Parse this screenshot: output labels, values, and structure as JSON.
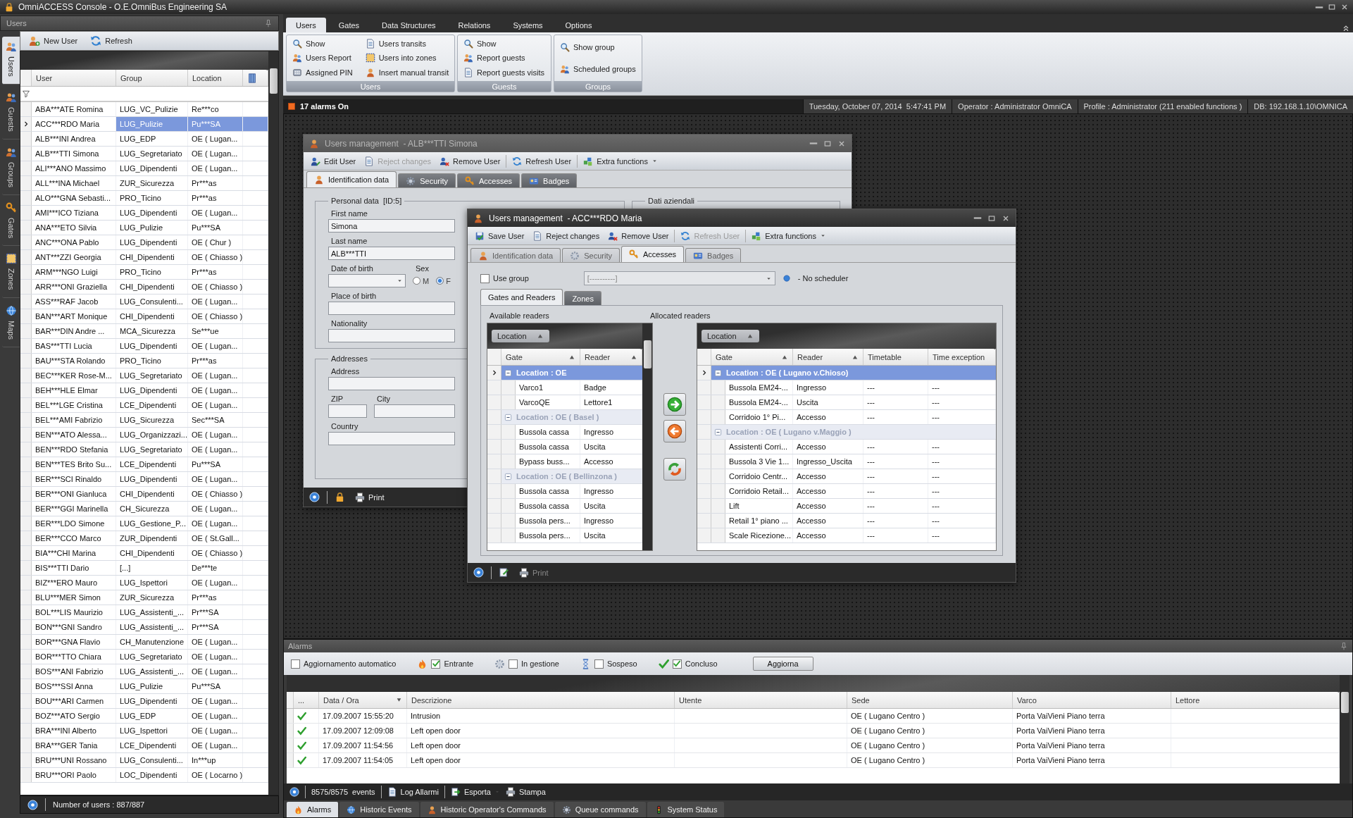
{
  "window": {
    "title": "OmniACCESS Console - O.E.OmniBus Engineering SA"
  },
  "side_tabs": [
    {
      "label": "Users",
      "selected": true
    },
    {
      "label": "Guests",
      "selected": false
    },
    {
      "label": "Groups",
      "selected": false
    },
    {
      "label": "Gates",
      "selected": false
    },
    {
      "label": "Zones",
      "selected": false
    },
    {
      "label": "Maps",
      "selected": false
    }
  ],
  "users_panel": {
    "title": "Users",
    "toolbar": [
      "New User",
      "Refresh"
    ],
    "columns": [
      "User",
      "Group",
      "Location"
    ],
    "rows": [
      {
        "user": "ABA***ATE Romina",
        "group": "LUG_VC_Pulizie",
        "location": "Re***co",
        "selected": false
      },
      {
        "user": "ACC***RDO Maria",
        "group": "LUG_Pulizie",
        "location": "Pu***SA",
        "selected": true
      },
      {
        "user": "ALB***INI Andrea",
        "group": "LUG_EDP",
        "location": "OE ( Lugan...",
        "selected": false
      },
      {
        "user": "ALB***TTI Simona",
        "group": "LUG_Segretariato",
        "location": "OE ( Lugan...",
        "selected": false
      },
      {
        "user": "ALI***ANO Massimo",
        "group": "LUG_Dipendenti",
        "location": "OE ( Lugan...",
        "selected": false
      },
      {
        "user": "ALL***INA Michael",
        "group": "ZUR_Sicurezza",
        "location": "Pr***as",
        "selected": false
      },
      {
        "user": "ALO***GNA Sebasti...",
        "group": "PRO_Ticino",
        "location": "Pr***as",
        "selected": false
      },
      {
        "user": "AMI***ICO Tiziana",
        "group": "LUG_Dipendenti",
        "location": "OE ( Lugan...",
        "selected": false
      },
      {
        "user": "ANA***ETO Silvia",
        "group": "LUG_Pulizie",
        "location": "Pu***SA",
        "selected": false
      },
      {
        "user": "ANC***ONA Pablo",
        "group": "LUG_Dipendenti",
        "location": "OE ( Chur )",
        "selected": false
      },
      {
        "user": "ANT***ZZI Georgia",
        "group": "CHI_Dipendenti",
        "location": "OE ( Chiasso )",
        "selected": false
      },
      {
        "user": "ARM***NGO Luigi",
        "group": "PRO_Ticino",
        "location": "Pr***as",
        "selected": false
      },
      {
        "user": "ARR***ONI Graziella",
        "group": "CHI_Dipendenti",
        "location": "OE ( Chiasso )",
        "selected": false
      },
      {
        "user": "ASS***RAF Jacob",
        "group": "LUG_Consulenti...",
        "location": "OE ( Lugan...",
        "selected": false
      },
      {
        "user": "BAN***ART Monique",
        "group": "CHI_Dipendenti",
        "location": "OE ( Chiasso )",
        "selected": false
      },
      {
        "user": "BAR***DIN Andre ...",
        "group": "MCA_Sicurezza",
        "location": "Se***ue",
        "selected": false
      },
      {
        "user": "BAS***TTI Lucia",
        "group": "LUG_Dipendenti",
        "location": "OE ( Lugan...",
        "selected": false
      },
      {
        "user": "BAU***STA Rolando",
        "group": "PRO_Ticino",
        "location": "Pr***as",
        "selected": false
      },
      {
        "user": "BEC***KER Rose-M...",
        "group": "LUG_Segretariato",
        "location": "OE ( Lugan...",
        "selected": false
      },
      {
        "user": "BEH***HLE Elmar",
        "group": "LUG_Dipendenti",
        "location": "OE ( Lugan...",
        "selected": false
      },
      {
        "user": "BEL***LGE Cristina",
        "group": "LCE_Dipendenti",
        "location": "OE ( Lugan...",
        "selected": false
      },
      {
        "user": "BEL***AMI Fabrizio",
        "group": "LUG_Sicurezza",
        "location": "Sec***SA",
        "selected": false
      },
      {
        "user": "BEN***ATO Alessa...",
        "group": "LUG_Organizzazi...",
        "location": "OE ( Lugan...",
        "selected": false
      },
      {
        "user": "BEN***RDO Stefania",
        "group": "LUG_Segretariato",
        "location": "OE ( Lugan...",
        "selected": false
      },
      {
        "user": "BEN***TES Brito Su...",
        "group": "LCE_Dipendenti",
        "location": "Pu***SA",
        "selected": false
      },
      {
        "user": "BER***SCI Rinaldo",
        "group": "LUG_Dipendenti",
        "location": "OE ( Lugan...",
        "selected": false
      },
      {
        "user": "BER***ONI Gianluca",
        "group": "CHI_Dipendenti",
        "location": "OE ( Chiasso )",
        "selected": false
      },
      {
        "user": "BER***GGI Marinella",
        "group": "CH_Sicurezza",
        "location": "OE ( Lugan...",
        "selected": false
      },
      {
        "user": "BER***LDO Simone",
        "group": "LUG_Gestione_P...",
        "location": "OE ( Lugan...",
        "selected": false
      },
      {
        "user": "BER***CCO Marco",
        "group": "ZUR_Dipendenti",
        "location": "OE ( St.Gall...",
        "selected": false
      },
      {
        "user": "BIA***CHI Marina",
        "group": "CHI_Dipendenti",
        "location": "OE ( Chiasso )",
        "selected": false
      },
      {
        "user": "BIS***TTI Dario",
        "group": "[...]",
        "location": "De***te",
        "selected": false
      },
      {
        "user": "BIZ***ERO Mauro",
        "group": "LUG_Ispettori",
        "location": "OE ( Lugan...",
        "selected": false
      },
      {
        "user": "BLU***MER Simon",
        "group": "ZUR_Sicurezza",
        "location": "Pr***as",
        "selected": false
      },
      {
        "user": "BOL***LIS Maurizio",
        "group": "LUG_Assistenti_...",
        "location": "Pr***SA",
        "selected": false
      },
      {
        "user": "BON***GNI Sandro",
        "group": "LUG_Assistenti_...",
        "location": "Pr***SA",
        "selected": false
      },
      {
        "user": "BOR***GNA Flavio",
        "group": "CH_Manutenzione",
        "location": "OE ( Lugan...",
        "selected": false
      },
      {
        "user": "BOR***TTO Chiara",
        "group": "LUG_Segretariato",
        "location": "OE ( Lugan...",
        "selected": false
      },
      {
        "user": "BOS***ANI Fabrizio",
        "group": "LUG_Assistenti_...",
        "location": "OE ( Lugan...",
        "selected": false
      },
      {
        "user": "BOS***SSI Anna",
        "group": "LUG_Pulizie",
        "location": "Pu***SA",
        "selected": false
      },
      {
        "user": "BOU***ARI Carmen",
        "group": "LUG_Dipendenti",
        "location": "OE ( Lugan...",
        "selected": false
      },
      {
        "user": "BOZ***ATO Sergio",
        "group": "LUG_EDP",
        "location": "OE ( Lugan...",
        "selected": false
      },
      {
        "user": "BRA***INI Alberto",
        "group": "LUG_Ispettori",
        "location": "OE ( Lugan...",
        "selected": false
      },
      {
        "user": "BRA***GER Tania",
        "group": "LCE_Dipendenti",
        "location": "OE ( Lugan...",
        "selected": false
      },
      {
        "user": "BRU***UNI Rossano",
        "group": "LUG_Consulenti...",
        "location": "In***up",
        "selected": false
      },
      {
        "user": "BRU***ORI Paolo",
        "group": "LOC_Dipendenti",
        "location": "OE ( Locarno )",
        "selected": false
      }
    ],
    "status": "Number of users : 887/887"
  },
  "ribbon": {
    "tabs": [
      {
        "label": "Users",
        "selected": true
      },
      {
        "label": "Gates",
        "selected": false
      },
      {
        "label": "Data Structures",
        "selected": false
      },
      {
        "label": "Relations",
        "selected": false
      },
      {
        "label": "Systems",
        "selected": false
      },
      {
        "label": "Options",
        "selected": false
      }
    ],
    "groups": [
      {
        "title": "Users",
        "items": [
          "Show",
          "Users Report",
          "Assigned PIN",
          "Users transits",
          "Users into zones",
          "Insert manual transit"
        ]
      },
      {
        "title": "Guests",
        "items": [
          "Show",
          "Report guests",
          "Report guests visits"
        ]
      },
      {
        "title": "Groups",
        "items": [
          "Show group",
          "Scheduled groups"
        ]
      }
    ]
  },
  "status_bar": {
    "alarms": "17 alarms On",
    "datetime": "Tuesday, October 07, 2014  5:47:41 PM",
    "operator": "Operator : Administrator OmniCA",
    "profile": "Profile : Administrator (211 enabled functions )",
    "db": "DB: 192.168.1.10\\OMNICA"
  },
  "windows": [
    {
      "kind": "identification",
      "title": "Users management  - ALB***TTI Simona",
      "active": false,
      "toolbar": [
        {
          "label": "Edit User",
          "disabled": false
        },
        {
          "label": "Reject changes",
          "disabled": true
        },
        {
          "label": "Remove User",
          "disabled": false
        },
        {
          "label": "Refresh User",
          "disabled": false
        },
        {
          "label": "Extra functions",
          "disabled": false
        }
      ],
      "tabs": [
        {
          "label": "Identification data",
          "selected": true,
          "disabled": false
        },
        {
          "label": "Security",
          "selected": false,
          "disabled": false
        },
        {
          "label": "Accesses",
          "selected": false,
          "disabled": false
        },
        {
          "label": "Badges",
          "selected": false,
          "disabled": false
        }
      ],
      "personal": {
        "title": "Personal data  [ID:5]",
        "first_name": {
          "label": "First name",
          "value": "Simona"
        },
        "last_name": {
          "label": "Last name",
          "value": "ALB***TTI"
        },
        "birth_date": {
          "label": "Date of birth"
        },
        "sex": {
          "label": "Sex",
          "options": [
            {
              "label": "M",
              "selected": false
            },
            {
              "label": "F",
              "selected": true
            }
          ]
        },
        "birth_place": {
          "label": "Place of birth"
        },
        "nationality": {
          "label": "Nationality"
        }
      },
      "addresses": {
        "title": "Addresses",
        "address": {
          "label": "Address"
        },
        "zip": {
          "label": "ZIP"
        },
        "city": {
          "label": "City"
        },
        "country": {
          "label": "Country"
        }
      },
      "company": {
        "title": "Dati aziendali"
      },
      "footer": {
        "print": "Print",
        "disabled": false
      }
    },
    {
      "kind": "accesses",
      "title": "Users management  - ACC***RDO Maria",
      "active": true,
      "toolbar": [
        {
          "label": "Save User",
          "disabled": false
        },
        {
          "label": "Reject changes",
          "disabled": false
        },
        {
          "label": "Remove User",
          "disabled": false
        },
        {
          "label": "Refresh User",
          "disabled": true
        },
        {
          "label": "Extra functions",
          "disabled": false
        }
      ],
      "tabs": [
        {
          "label": "Identification data",
          "selected": false,
          "disabled": true
        },
        {
          "label": "Security",
          "selected": false,
          "disabled": true
        },
        {
          "label": "Accesses",
          "selected": true,
          "disabled": false
        },
        {
          "label": "Badges",
          "selected": false,
          "disabled": true
        }
      ],
      "use_group": {
        "label": "Use group",
        "checked": false
      },
      "group_select": {
        "value": "[----------]"
      },
      "scheduler": "- No scheduler",
      "subtabs": [
        {
          "label": "Gates and Readers",
          "selected": true
        },
        {
          "label": "Zones",
          "selected": false
        }
      ],
      "available": {
        "title": "Available readers",
        "group_by": "Location",
        "columns": [
          "Gate",
          "Reader"
        ],
        "rows": [
          {
            "kind": "group",
            "label": "Location : OE",
            "selected": true
          },
          {
            "kind": "item",
            "cells": [
              "Varco1",
              "Badge"
            ],
            "selected": false
          },
          {
            "kind": "item",
            "cells": [
              "VarcoQE",
              "Lettore1"
            ],
            "selected": false
          },
          {
            "kind": "group",
            "label": "Location : OE ( Basel )",
            "selected": false
          },
          {
            "kind": "item",
            "cells": [
              "Bussola cassa",
              "Ingresso"
            ],
            "selected": false
          },
          {
            "kind": "item",
            "cells": [
              "Bussola cassa",
              "Uscita"
            ],
            "selected": false
          },
          {
            "kind": "item",
            "cells": [
              "Bypass buss...",
              "Accesso"
            ],
            "selected": false
          },
          {
            "kind": "group",
            "label": "Location : OE ( Bellinzona )",
            "selected": false
          },
          {
            "kind": "item",
            "cells": [
              "Bussola cassa",
              "Ingresso"
            ],
            "selected": false
          },
          {
            "kind": "item",
            "cells": [
              "Bussola cassa",
              "Uscita"
            ],
            "selected": false
          },
          {
            "kind": "item",
            "cells": [
              "Bussola pers...",
              "Ingresso"
            ],
            "selected": false
          },
          {
            "kind": "item",
            "cells": [
              "Bussola pers...",
              "Uscita"
            ],
            "selected": false
          }
        ]
      },
      "allocated": {
        "title": "Allocated readers",
        "group_by": "Location",
        "columns": [
          "Gate",
          "Reader",
          "Timetable",
          "Time exception"
        ],
        "rows": [
          {
            "kind": "group",
            "label": "Location : OE ( Lugano v.Chioso)",
            "selected": true
          },
          {
            "kind": "item",
            "cells": [
              "Bussola EM24-...",
              "Ingresso",
              "---",
              "---"
            ],
            "selected": false
          },
          {
            "kind": "item",
            "cells": [
              "Bussola EM24-...",
              "Uscita",
              "---",
              "---"
            ],
            "selected": false
          },
          {
            "kind": "item",
            "cells": [
              "Corridoio 1° Pi...",
              "Accesso",
              "---",
              "---"
            ],
            "selected": false
          },
          {
            "kind": "group",
            "label": "Location : OE ( Lugano v.Maggio )",
            "selected": false
          },
          {
            "kind": "item",
            "cells": [
              "Assistenti Corri...",
              "Accesso",
              "---",
              "---"
            ],
            "selected": false
          },
          {
            "kind": "item",
            "cells": [
              "Bussola 3 Vie 1...",
              "Ingresso_Uscita",
              "---",
              "---"
            ],
            "selected": false
          },
          {
            "kind": "item",
            "cells": [
              "Corridoio Centr...",
              "Accesso",
              "---",
              "---"
            ],
            "selected": false
          },
          {
            "kind": "item",
            "cells": [
              "Corridoio Retail...",
              "Accesso",
              "---",
              "---"
            ],
            "selected": false
          },
          {
            "kind": "item",
            "cells": [
              "Lift",
              "Accesso",
              "---",
              "---"
            ],
            "selected": false
          },
          {
            "kind": "item",
            "cells": [
              "Retail 1° piano ...",
              "Accesso",
              "---",
              "---"
            ],
            "selected": false
          },
          {
            "kind": "item",
            "cells": [
              "Scale Ricezione...",
              "Accesso",
              "---",
              "---"
            ],
            "selected": false
          }
        ]
      },
      "footer": {
        "print": "Print",
        "disabled": true
      }
    }
  ],
  "alarms": {
    "title": "Alarms",
    "filters": [
      {
        "label": "Aggiornamento automatico",
        "checked": false
      },
      {
        "label": "Entrante",
        "checked": true
      },
      {
        "label": "In gestione",
        "checked": false
      },
      {
        "label": "Sospeso",
        "checked": false
      },
      {
        "label": "Concluso",
        "checked": true
      }
    ],
    "refresh_button": "Aggiorna",
    "columns": [
      "...",
      "Data / Ora",
      "Descrizione",
      "Utente",
      "Sede",
      "Varco",
      "Lettore"
    ],
    "rows": [
      {
        "date": "17.09.2007 15:55:20",
        "description": "Intrusion",
        "site": "OE ( Lugano Centro )",
        "gate": "Porta VaiVieni Piano terra"
      },
      {
        "date": "17.09.2007 12:09:08",
        "description": "Left open door",
        "site": "OE ( Lugano Centro )",
        "gate": "Porta VaiVieni Piano terra"
      },
      {
        "date": "17.09.2007 11:54:56",
        "description": "Left open door",
        "site": "OE ( Lugano Centro )",
        "gate": "Porta VaiVieni Piano terra"
      },
      {
        "date": "17.09.2007 11:54:05",
        "description": "Left open door",
        "site": "OE ( Lugano Centro )",
        "gate": "Porta VaiVieni Piano terra"
      }
    ],
    "footer": {
      "events": "8575/8575  events",
      "log": "Log Allarmi",
      "export": "Esporta",
      "print": "Stampa"
    },
    "tabs": [
      {
        "label": "Alarms",
        "selected": true
      },
      {
        "label": "Historic Events",
        "selected": false
      },
      {
        "label": "Historic Operator's Commands",
        "selected": false
      },
      {
        "label": "Queue commands",
        "selected": false
      },
      {
        "label": "System Status",
        "selected": false
      }
    ]
  }
}
